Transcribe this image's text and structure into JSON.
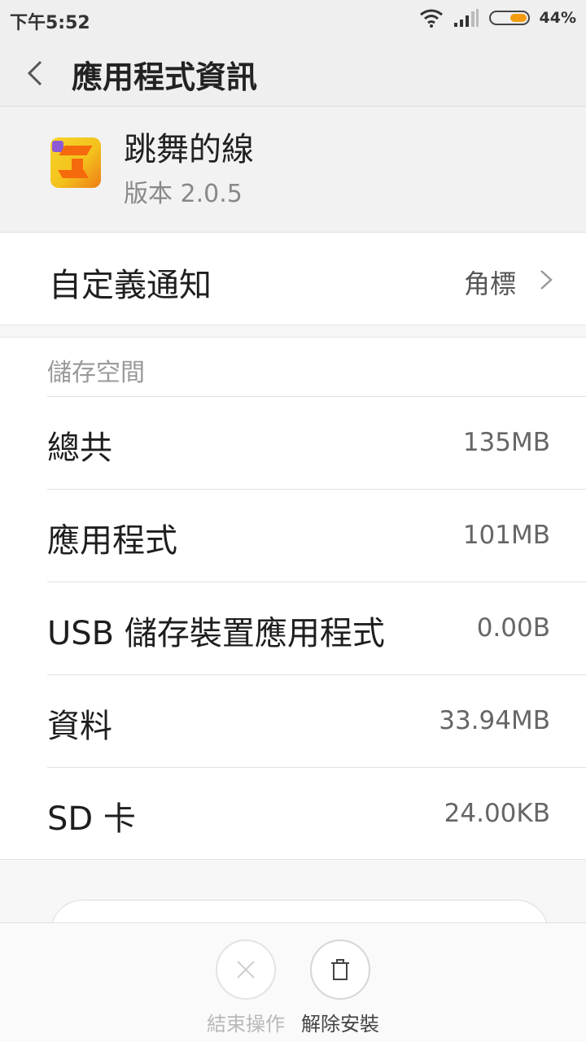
{
  "status": {
    "time": "下午5:52",
    "battery": "44%"
  },
  "appbar": {
    "title": "應用程式資訊"
  },
  "app": {
    "name": "跳舞的線",
    "version": "版本 2.0.5"
  },
  "notification": {
    "label": "自定義通知",
    "value": "角標"
  },
  "storage": {
    "title": "儲存空間",
    "rows": [
      {
        "label": "總共",
        "value": "135MB"
      },
      {
        "label": "應用程式",
        "value": "101MB"
      },
      {
        "label": "USB 儲存裝置應用程式",
        "value": "0.00B"
      },
      {
        "label": "資料",
        "value": "33.94MB"
      },
      {
        "label": "SD 卡",
        "value": "24.00KB"
      }
    ]
  },
  "actions": {
    "force_stop": "結束操作",
    "uninstall": "解除安裝"
  }
}
